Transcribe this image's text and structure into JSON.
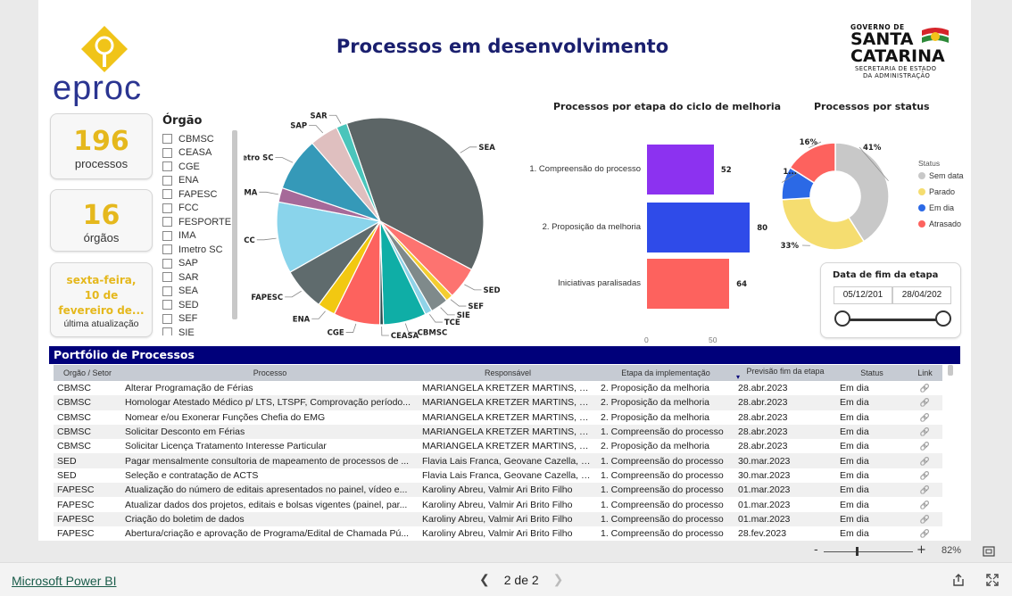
{
  "report": {
    "title": "Processos em desenvolvimento",
    "logo_text": "eproc",
    "gov_logo": {
      "line1": "GOVERNO DE",
      "line2": "SANTA",
      "line3": "CATARINA",
      "line4": "SECRETARIA DE ESTADO",
      "line5": "DA ADMINISTRAÇÃO"
    }
  },
  "kpis": [
    {
      "value": "196",
      "label": "processos"
    },
    {
      "value": "16",
      "label": "órgãos"
    }
  ],
  "update_card": {
    "line1": "sexta-feira,",
    "line2": "10 de",
    "line3": "fevereiro de...",
    "label": "última atualização"
  },
  "slicer": {
    "title": "Órgão",
    "items": [
      "CBMSC",
      "CEASA",
      "CGE",
      "ENA",
      "FAPESC",
      "FCC",
      "FESPORTE",
      "IMA",
      "Imetro SC",
      "SAP",
      "SAR",
      "SEA",
      "SED",
      "SEF",
      "SIE"
    ]
  },
  "pie_labels": [
    "SED",
    "SEF",
    "SIE",
    "TCE",
    "CBMSC",
    "CEASA",
    "CGE",
    "ENA",
    "FAPESC",
    "FCC",
    "IMA",
    "Imetro SC",
    "SAP",
    "SAR",
    "SEA"
  ],
  "chart_data": [
    {
      "type": "pie",
      "title": "",
      "labels": [
        "SEA",
        "SED",
        "SEF",
        "SIE",
        "TCE",
        "CBMSC",
        "CEASA",
        "CGE",
        "ENA",
        "FAPESC",
        "FCC",
        "IMA",
        "Imetro SC",
        "SAP",
        "SAR"
      ],
      "values": [
        68,
        9,
        2,
        5,
        2,
        12,
        1,
        13,
        5,
        12,
        20,
        4,
        15,
        8,
        3
      ],
      "colors": [
        "#5c6566",
        "#fd7370",
        "#f4cd31",
        "#7f8a8b",
        "#8fd3e8",
        "#0faea6",
        "#2d4a4d",
        "#fd625e",
        "#f2c811",
        "#5f6b6d",
        "#8ad4eb",
        "#a66999",
        "#3599b8",
        "#dfbfbf",
        "#4ac5bb"
      ]
    },
    {
      "type": "bar",
      "title": "Processos por etapa do ciclo de melhoria",
      "categories": [
        "1. Compreensão do processo",
        "2. Proposição da melhoria",
        "Iniciativas paralisadas"
      ],
      "values": [
        52,
        80,
        64
      ],
      "colors": [
        "#8c32f0",
        "#2f4be9",
        "#fd625e"
      ],
      "xticks": [
        "0",
        "50"
      ],
      "xlim": [
        0,
        100
      ]
    },
    {
      "type": "pie",
      "title": "Processos por status",
      "legend_title": "Status",
      "labels": [
        "Sem data",
        "Parado",
        "Em dia",
        "Atrasado"
      ],
      "values": [
        41,
        33,
        10,
        16
      ],
      "value_labels": [
        "41%",
        "33%",
        "1...",
        "16%"
      ],
      "colors": [
        "#c8c8c8",
        "#f5dd70",
        "#2b69e6",
        "#fd625e"
      ]
    }
  ],
  "date_slicer": {
    "title": "Data de fim da etapa",
    "start": "05/12/201",
    "end": "28/04/202"
  },
  "portfolio": {
    "title": "Portfólio de Processos",
    "columns": [
      "Orgão / Setor",
      "Processo",
      "Responsável",
      "Etapa da implementação",
      "Previsão fim da etapa",
      "Status",
      "Link"
    ],
    "rows": [
      [
        "CBMSC",
        "Alterar Programação de Férias",
        "MARIANGELA KRETZER  MARTINS, Nil...",
        "2. Proposição da melhoria",
        "28.abr.2023",
        "Em dia"
      ],
      [
        "CBMSC",
        "Homologar Atestado Médico p/ LTS, LTSPF, Comprovação período...",
        "MARIANGELA KRETZER  MARTINS, Nil...",
        "2. Proposição da melhoria",
        "28.abr.2023",
        "Em dia"
      ],
      [
        "CBMSC",
        "Nomear e/ou Exonerar Funções Chefia do EMG",
        "MARIANGELA KRETZER  MARTINS, Nil...",
        "2. Proposição da melhoria",
        "28.abr.2023",
        "Em dia"
      ],
      [
        "CBMSC",
        "Solicitar Desconto em Férias",
        "MARIANGELA KRETZER  MARTINS, Nil...",
        "1. Compreensão do processo",
        "28.abr.2023",
        "Em dia"
      ],
      [
        "CBMSC",
        "Solicitar Licença Tratamento Interesse Particular",
        "MARIANGELA KRETZER  MARTINS, Nil...",
        "2. Proposição da melhoria",
        "28.abr.2023",
        "Em dia"
      ],
      [
        "SED",
        "Pagar mensalmente consultoria de mapeamento de processos de ...",
        "Flavia Lais Franca, Geovane Cazella, M...",
        "1. Compreensão do processo",
        "30.mar.2023",
        "Em dia"
      ],
      [
        "SED",
        "Seleção e contratação de ACTS",
        "Flavia Lais Franca, Geovane Cazella, M...",
        "1. Compreensão do processo",
        "30.mar.2023",
        "Em dia"
      ],
      [
        "FAPESC",
        "Atualização do número de editais apresentados no painel, vídeo e...",
        "Karoliny Abreu, Valmir Ari Brito Filho",
        "1. Compreensão do processo",
        "01.mar.2023",
        "Em dia"
      ],
      [
        "FAPESC",
        "Atualizar dados dos projetos, editais e bolsas vigentes (painel, par...",
        "Karoliny Abreu, Valmir Ari Brito Filho",
        "1. Compreensão do processo",
        "01.mar.2023",
        "Em dia"
      ],
      [
        "FAPESC",
        "Criação do boletim de dados",
        "Karoliny Abreu, Valmir Ari Brito Filho",
        "1. Compreensão do processo",
        "01.mar.2023",
        "Em dia"
      ],
      [
        "FAPESC",
        "Abertura/criação e aprovação de Programa/Edital de Chamada Pú...",
        "Karoliny Abreu, Valmir Ari Brito Filho",
        "1. Compreensão do processo",
        "28.fev.2023",
        "Em dia"
      ]
    ]
  },
  "statusbar": {
    "zoom": "82%",
    "minus": "-",
    "plus": "+"
  },
  "footer": {
    "brand": "Microsoft Power BI",
    "page": "2 de 2"
  }
}
